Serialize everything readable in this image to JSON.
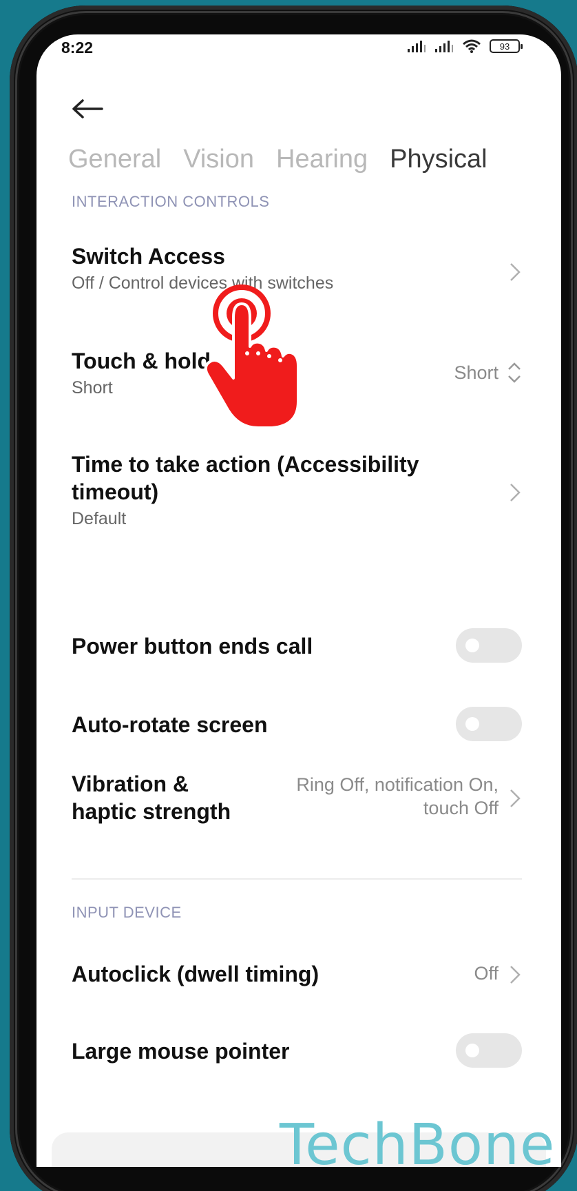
{
  "status_bar": {
    "time": "8:22",
    "battery": "93"
  },
  "tabs": [
    {
      "label": "General",
      "active": false
    },
    {
      "label": "Vision",
      "active": false
    },
    {
      "label": "Hearing",
      "active": false
    },
    {
      "label": "Physical",
      "active": true
    }
  ],
  "interaction_controls": {
    "header": "INTERACTION CONTROLS",
    "switch_access": {
      "title": "Switch Access",
      "subtitle": "Off / Control devices with switches"
    },
    "touch_hold": {
      "title": "Touch & hold",
      "subtitle": "Short",
      "value": "Short"
    },
    "time_to_take_action": {
      "title": "Time to take action (Accessibility timeout)",
      "subtitle": "Default"
    },
    "power_button": {
      "title": "Power button ends call",
      "enabled": false
    },
    "auto_rotate": {
      "title": "Auto-rotate screen",
      "enabled": false
    },
    "vibration": {
      "title": "Vibration & haptic strength",
      "value_line1": "Ring Off, notification On,",
      "value_line2": "touch Off"
    }
  },
  "input_device": {
    "header": "INPUT DEVICE",
    "autoclick": {
      "title": "Autoclick (dwell timing)",
      "value": "Off"
    },
    "large_pointer": {
      "title": "Large mouse pointer",
      "enabled": false
    }
  },
  "watermark": "TechBone",
  "colors": {
    "background": "#167a8c",
    "section_header": "#8f93b5",
    "hand": "#f01c1c",
    "watermark": "#6cc6d2"
  }
}
